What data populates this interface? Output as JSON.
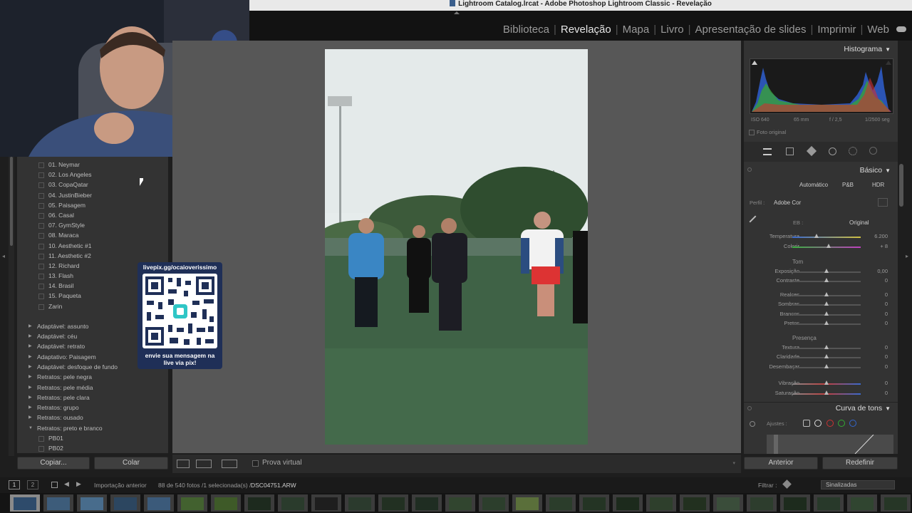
{
  "title_bar": {
    "text": "Lightroom Catalog.lrcat - Adobe Photoshop Lightroom Classic - Revelação"
  },
  "modules": [
    {
      "label": "Biblioteca",
      "active": false
    },
    {
      "label": "Revelação",
      "active": true
    },
    {
      "label": "Mapa",
      "active": false
    },
    {
      "label": "Livro",
      "active": false
    },
    {
      "label": "Apresentação de slides",
      "active": false
    },
    {
      "label": "Imprimir",
      "active": false
    },
    {
      "label": "Web",
      "active": false
    }
  ],
  "presets": {
    "user_presets": [
      "01. Neymar",
      "02. Los Angeles",
      "03. CopaQatar",
      "04. JustinBieber",
      "05. Paisagem",
      "06. Casal",
      "07. GymStyle",
      "08. Maraca",
      "10. Aesthetic #1",
      "11. Aesthetic #2",
      "12. Richard",
      "13. Flash",
      "14. Brasil",
      "15. Paqueta",
      "Zarin"
    ],
    "folders": [
      "Adaptável: assunto",
      "Adaptável: céu",
      "Adaptável: retrato",
      "Adaptativo: Paisagem",
      "Adaptável: desfoque de fundo",
      "Retratos: pele negra",
      "Retratos: pele média",
      "Retratos: pele clara",
      "Retratos: grupo",
      "Retratos: ousado",
      "Retratos: preto e branco"
    ],
    "bw_items": [
      "PB01",
      "PB02"
    ]
  },
  "left_buttons": {
    "copy": "Copiar...",
    "paste": "Colar"
  },
  "qr": {
    "top": "livepix.gg/ocaioverissimo",
    "bottom_line1": "envie sua mensagem na",
    "bottom_line2": "live via pix!"
  },
  "toolbar": {
    "soft_proof": "Prova virtual"
  },
  "histogram": {
    "title": "Histograma",
    "iso": "ISO 640",
    "focal": "65 mm",
    "aperture": "f / 2,5",
    "shutter": "1/2500 seg",
    "original_photo": "Foto original"
  },
  "basic": {
    "title": "Básico",
    "treatment": [
      "Automático",
      "P&B",
      "HDR"
    ],
    "profile_label": "Perfil :",
    "profile_value": "Adobe Cor",
    "wb_label": "EB :",
    "wb_value": "Original",
    "temp": {
      "label": "Temperatura",
      "value": "6.200",
      "pos": 0.35
    },
    "tint": {
      "label": "Colorir",
      "value": "+ 8",
      "pos": 0.53
    },
    "tone_header": "Tom",
    "tone": [
      {
        "label": "Exposição",
        "value": "0,00",
        "pos": 0.5
      },
      {
        "label": "Contraste",
        "value": "0",
        "pos": 0.5
      },
      {
        "label": "Realces",
        "value": "0",
        "pos": 0.5
      },
      {
        "label": "Sombras",
        "value": "0",
        "pos": 0.5
      },
      {
        "label": "Brancos",
        "value": "0",
        "pos": 0.5
      },
      {
        "label": "Pretos",
        "value": "0",
        "pos": 0.5
      }
    ],
    "presence_header": "Presença",
    "presence": [
      {
        "label": "Textura",
        "value": "0",
        "pos": 0.5
      },
      {
        "label": "Claridade",
        "value": "0",
        "pos": 0.5
      },
      {
        "label": "Desembaçar",
        "value": "0",
        "pos": 0.5
      },
      {
        "label": "Vibração",
        "value": "0",
        "pos": 0.5
      },
      {
        "label": "Saturação",
        "value": "0",
        "pos": 0.5
      }
    ]
  },
  "tone_curve": {
    "title": "Curva de tons",
    "adjustments": "Ajustes :"
  },
  "right_buttons": {
    "previous": "Anterior",
    "reset": "Redefinir"
  },
  "filmbar": {
    "page1": "1",
    "page2": "2",
    "source": "Importação anterior",
    "count": "88 de 540 fotos /1 selecionada(s) /",
    "filename": "DSC04751.ARW",
    "filter_label": "Filtrar :",
    "filter_value": "Sinalizadas"
  },
  "colors": {
    "accent_selected": "#ffffff",
    "panel_bg": "#333333",
    "center_bg": "#575757"
  }
}
